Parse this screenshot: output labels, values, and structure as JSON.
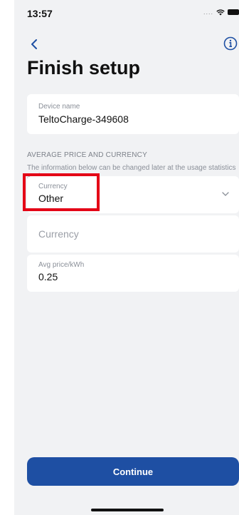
{
  "status_bar": {
    "time": "13:57",
    "signal": "....",
    "wifi_icon": "wifi-icon",
    "battery_icon": "battery-icon"
  },
  "nav": {
    "back_icon": "chevron-left-icon",
    "info_icon": "info-icon"
  },
  "title": "Finish setup",
  "device": {
    "label": "Device name",
    "value": "TeltoCharge-349608"
  },
  "section": {
    "heading": "AVERAGE PRICE AND CURRENCY",
    "description": "The information below can be changed later at the usage statistics settings."
  },
  "currency_select": {
    "label": "Currency",
    "value": "Other"
  },
  "currency_input": {
    "placeholder": "Currency"
  },
  "price": {
    "label": "Avg price/kWh",
    "value": "0.25"
  },
  "continue_label": "Continue",
  "colors": {
    "accent": "#1e4fa3",
    "highlight": "#e40016",
    "background": "#f1f2f4"
  }
}
